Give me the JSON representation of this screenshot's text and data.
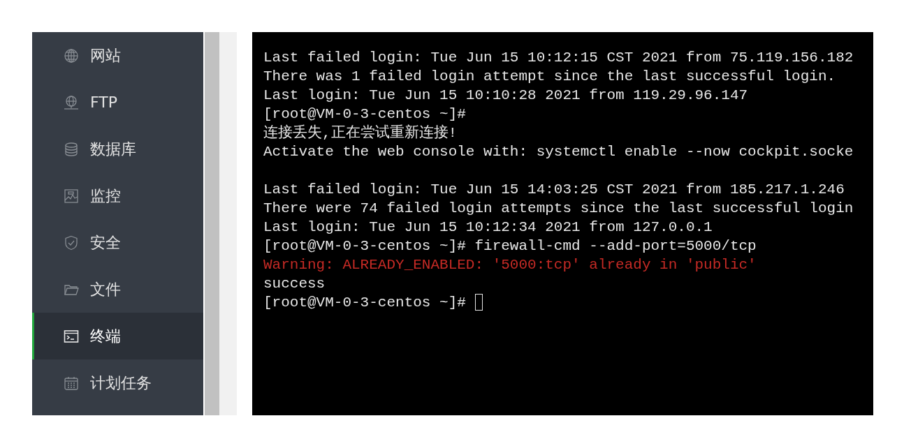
{
  "sidebar": {
    "items": [
      {
        "label": "网站",
        "selected": false
      },
      {
        "label": "FTP",
        "selected": false
      },
      {
        "label": "数据库",
        "selected": false
      },
      {
        "label": "监控",
        "selected": false
      },
      {
        "label": "安全",
        "selected": false
      },
      {
        "label": "文件",
        "selected": false
      },
      {
        "label": "终端",
        "selected": true
      },
      {
        "label": "计划任务",
        "selected": false
      }
    ]
  },
  "terminal": {
    "lines": [
      {
        "kind": "text",
        "text": "Last failed login: Tue Jun 15 10:12:15 CST 2021 from 75.119.156.182"
      },
      {
        "kind": "text",
        "text": "There was 1 failed login attempt since the last successful login."
      },
      {
        "kind": "text",
        "text": "Last login: Tue Jun 15 10:10:28 2021 from 119.29.96.147"
      },
      {
        "kind": "text",
        "text": "[root@VM-0-3-centos ~]#"
      },
      {
        "kind": "text",
        "text": "连接丢失,正在尝试重新连接!"
      },
      {
        "kind": "text",
        "text": "Activate the web console with: systemctl enable --now cockpit.socke"
      },
      {
        "kind": "blank"
      },
      {
        "kind": "text",
        "text": "Last failed login: Tue Jun 15 14:03:25 CST 2021 from 185.217.1.246"
      },
      {
        "kind": "text",
        "text": "There were 74 failed login attempts since the last successful login"
      },
      {
        "kind": "text",
        "text": "Last login: Tue Jun 15 10:12:34 2021 from 127.0.0.1"
      },
      {
        "kind": "text",
        "text": "[root@VM-0-3-centos ~]# firewall-cmd --add-port=5000/tcp"
      },
      {
        "kind": "warning",
        "text": "Warning: ALREADY_ENABLED: '5000:tcp' already in 'public'"
      },
      {
        "kind": "text",
        "text": "success"
      },
      {
        "kind": "prompt",
        "text": "[root@VM-0-3-centos ~]#",
        "cursor": true
      }
    ]
  }
}
